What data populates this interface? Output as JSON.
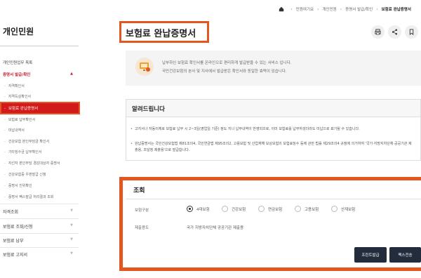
{
  "breadcrumb": {
    "items": [
      "민원여기요",
      "개인민원",
      "증명서 발급/확인",
      "보험료 완납증명서"
    ]
  },
  "sidebar": {
    "title": "개인민원",
    "items": [
      {
        "label": "개인민원업무 목록"
      },
      {
        "label": "증명서 발급/확인",
        "subitems": [
          "자격확인서",
          "자격득실확인서",
          "보험료 완납증명서",
          "보험료 납부확인서",
          "미납내역서",
          "건강보험 본인부담금 확인서",
          "기타징수금 납부확인서",
          "자선자 본인부담 경감대상자 증명서",
          "건강보험증 우편발급 신청",
          "증명서 진위확인",
          "증명서 팩스발급 처리결과 조회"
        ]
      },
      {
        "label": "자격조회"
      },
      {
        "label": "보험료 조회/신청"
      },
      {
        "label": "보험료 납부"
      },
      {
        "label": "보험료 고지서"
      }
    ]
  },
  "page": {
    "title": "보험료 완납증명서"
  },
  "intro": {
    "line1": "납부하신 보험료 확인서를 온라인으로 편리하게 발급받을 수 있는 서비스 입니다.",
    "line2": "국민건강보험의 본사 및 지사에서 발급받은 확인서와 동일한 효력이 있습니다."
  },
  "notice": {
    "title": "알려드립니다",
    "b1": "고지서나 자동이체로 보험료 납부 시 2~3일(영업일 기준) 정도 지나 납부내역이 반영되므로, 이미 보험료를 납부하셨더라도 미납으로 표기될 수 있습니다.",
    "b2": "완납증명서는 국민건강보험법 제81조의4, 국민연금법 제95조의2, 고용보험 및 산업재해 보상보험의 보험료징수 등에 관한 법률 제29조의4 규정에 의거하여 '국가·지방자치단체·공공기관 제출용, 조달청 제출용'으로 발급합니다."
  },
  "query": {
    "title": "조회",
    "insurance_label": "보험구분",
    "options": [
      "4대보험",
      "건강보험",
      "연금보험",
      "고용보험",
      "산재보험"
    ],
    "purpose_label": "제출용도",
    "purpose_value": "국가 지방자치단체 공공기관 제출용",
    "print_button": "프린트발급",
    "fax_button": "팩스전송"
  }
}
